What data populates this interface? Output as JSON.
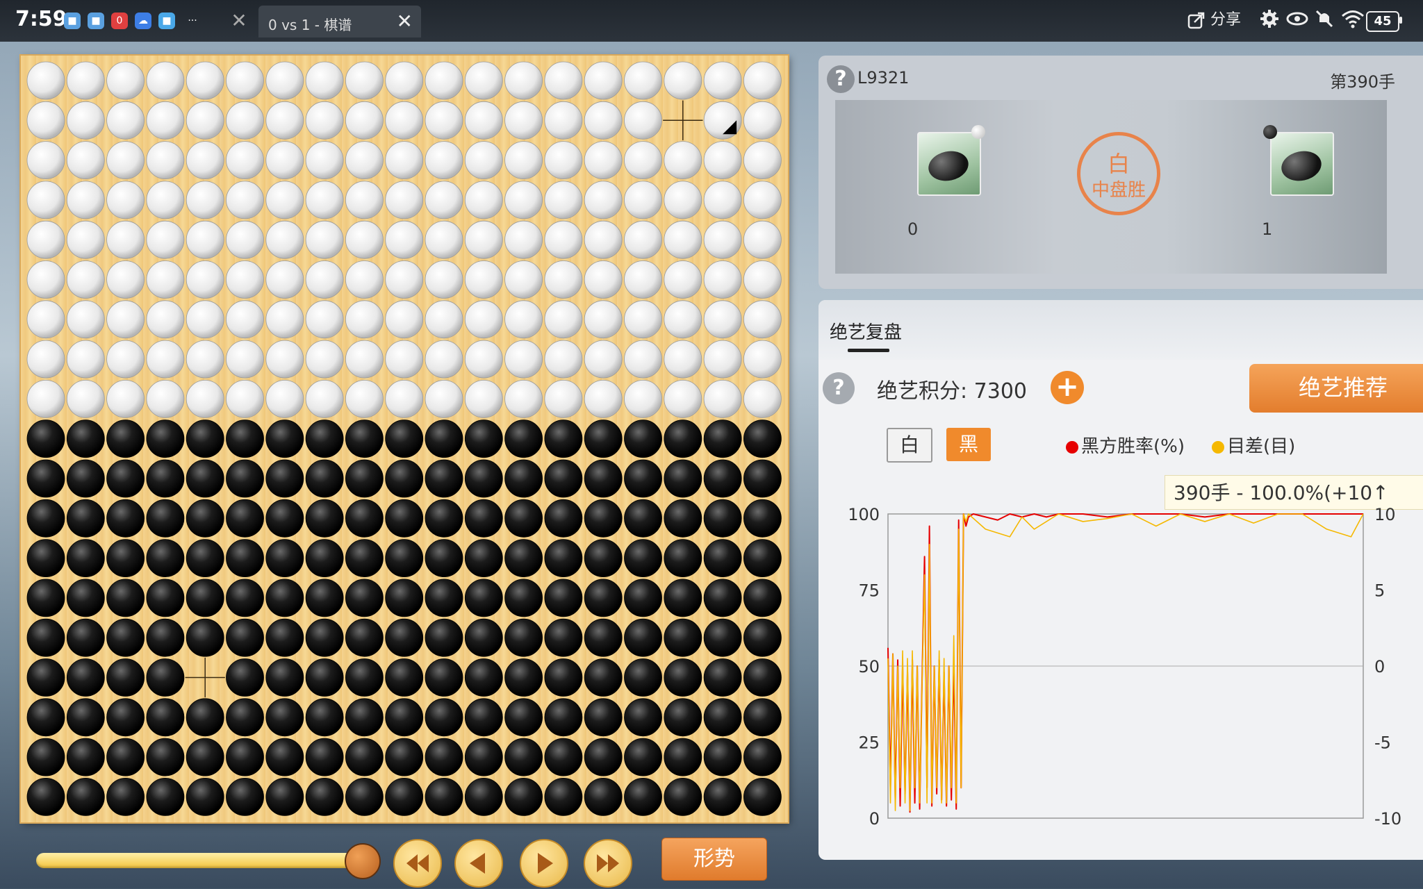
{
  "status_bar": {
    "time": "7:59",
    "battery": "45",
    "more": "···"
  },
  "tabs": [
    {
      "label": "0 vs 1 - 棋谱",
      "close": "✕"
    }
  ],
  "tab1_close": "✕",
  "toolbar": {
    "share_label": "分享"
  },
  "colors": {
    "accent": "#f08a2c",
    "win_rate": "#e60000",
    "score_diff": "#f5b800"
  },
  "game": {
    "id": "L9321",
    "move": "第390手",
    "white_captures": "0",
    "black_captures": "1",
    "result_line1": "白",
    "result_line2": "中盘胜"
  },
  "board": {
    "size": 19,
    "white_rows": 9,
    "black_rows": 10,
    "empty_points": [
      [
        16,
        1
      ],
      [
        4,
        15
      ]
    ],
    "last_move": [
      17,
      1
    ]
  },
  "controls": {
    "progress": 1.0,
    "icons": [
      "fast-backward-icon",
      "step-backward-icon",
      "step-forward-icon",
      "fast-forward-icon"
    ],
    "position_label": "形势"
  },
  "analysis": {
    "tab_label": "绝艺复盘",
    "score_label": "绝艺积分: 7300",
    "plus": "+",
    "recommend_label": "绝艺推荐",
    "white_btn": "白",
    "black_btn": "黑",
    "legend_win": "黑方胜率(%)",
    "legend_diff": "目差(目)",
    "tooltip": "390手 - 100.0%(+10↑"
  },
  "chart_data": {
    "type": "line",
    "x_range": [
      0,
      390
    ],
    "y_left": {
      "range": [
        0,
        100
      ],
      "ticks": [
        "100",
        "75",
        "50",
        "25",
        "0"
      ]
    },
    "y_right": {
      "range": [
        -10,
        10
      ],
      "ticks": [
        "10",
        "5",
        "0",
        "-5",
        "-10"
      ]
    },
    "series": [
      {
        "name": "黑方胜率(%)",
        "color": "#e60000",
        "x": [
          0,
          2,
          4,
          6,
          8,
          10,
          12,
          14,
          16,
          18,
          20,
          22,
          24,
          26,
          28,
          30,
          32,
          34,
          36,
          38,
          40,
          42,
          44,
          46,
          48,
          50,
          52,
          54,
          56,
          58,
          60,
          62,
          64,
          66,
          70,
          80,
          90,
          100,
          110,
          120,
          130,
          140,
          160,
          180,
          200,
          220,
          240,
          260,
          280,
          300,
          320,
          340,
          360,
          380,
          390
        ],
        "values": [
          56,
          10,
          54,
          6,
          52,
          4,
          50,
          8,
          48,
          2,
          52,
          5,
          50,
          3,
          46,
          86,
          10,
          96,
          4,
          50,
          8,
          52,
          6,
          48,
          4,
          50,
          6,
          52,
          3,
          98,
          10,
          100,
          96,
          99,
          100,
          99,
          98,
          100,
          99,
          100,
          99,
          100,
          100,
          99,
          100,
          100,
          100,
          99,
          100,
          100,
          100,
          100,
          100,
          100,
          100
        ]
      },
      {
        "name": "目差(目)",
        "color": "#f5b800",
        "x": [
          0,
          2,
          4,
          6,
          8,
          10,
          12,
          14,
          16,
          18,
          20,
          22,
          24,
          26,
          28,
          30,
          32,
          34,
          36,
          38,
          40,
          42,
          44,
          46,
          48,
          50,
          52,
          54,
          56,
          58,
          60,
          62,
          64,
          66,
          80,
          100,
          110,
          120,
          140,
          160,
          180,
          200,
          220,
          240,
          260,
          280,
          300,
          320,
          340,
          360,
          380,
          390
        ],
        "values": [
          0.5,
          -9,
          0.8,
          -9.5,
          0,
          -8,
          1,
          -9,
          0.5,
          -9.5,
          1,
          -8,
          0,
          -9,
          -1,
          6,
          -9,
          8,
          -9,
          0,
          -8,
          1,
          -9,
          0.5,
          -9,
          0,
          -8,
          2,
          -9,
          9,
          -8,
          10,
          9.5,
          10,
          9,
          8.5,
          9.8,
          9,
          10,
          9.5,
          9.7,
          10,
          9.2,
          10,
          9.5,
          10,
          9.4,
          10,
          10,
          9,
          8.5,
          10
        ]
      }
    ]
  }
}
